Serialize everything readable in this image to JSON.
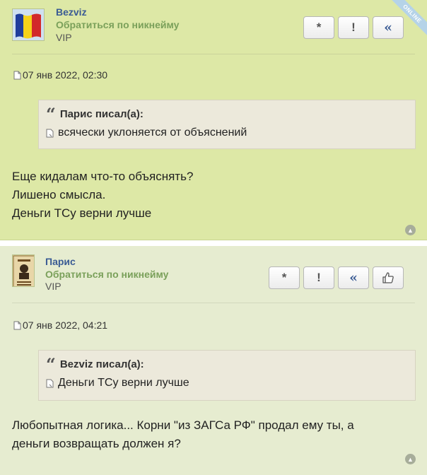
{
  "posts": [
    {
      "author": "Bezviz",
      "pm_link": "Обратиться по никнейму",
      "rank": "VIP",
      "online_badge": "ONLINE",
      "date": "07 янв 2022, 02:30",
      "quote": {
        "header": "Парис писал(а):",
        "text": "всячески уклоняется от объяснений"
      },
      "message": [
        "Еще кидалам что-то объяснять?",
        "Лишено смысла.",
        "Деньги ТСу верни лучше"
      ],
      "buttons": {
        "report": "*",
        "warn": "!",
        "quote": "«"
      }
    },
    {
      "author": "Парис",
      "pm_link": "Обратиться по никнейму",
      "rank": "VIP",
      "date": "07 янв 2022, 04:21",
      "quote": {
        "header": "Bezviz писал(а):",
        "text": "Деньги ТСу верни лучше"
      },
      "message": [
        "Любопытная логика... Корни \"из ЗАГСа РФ\" продал ему ты, а",
        "деньги возвращать должен я?"
      ],
      "buttons": {
        "report": "*",
        "warn": "!",
        "quote": "«"
      }
    }
  ],
  "icons": [
    "post-icon",
    "quote-doc-icon",
    "thumbs-up-icon",
    "back-to-top-icon",
    "flag-avatar",
    "wanted-poster-avatar"
  ],
  "colors": {
    "post1_bg": "#dde8a6",
    "post2_bg": "#e6ecd0",
    "author": "#3a5b94",
    "pm_link": "#7aa05a",
    "quote_bg": "#ece9db"
  }
}
